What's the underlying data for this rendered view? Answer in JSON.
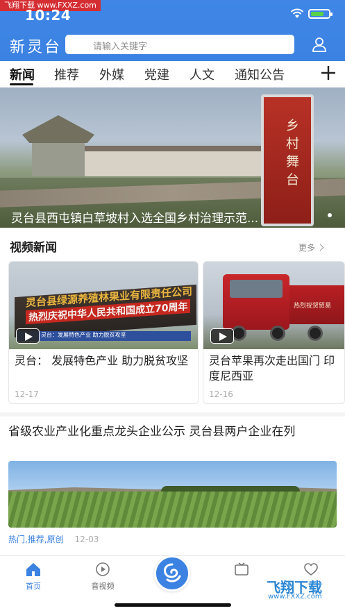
{
  "status_bar": {
    "time": "10:24",
    "watermark_tag": "飞翔下载 www.FXXZ.com"
  },
  "header": {
    "brand": "新灵台",
    "search_placeholder": "请输入关键字",
    "accent_color": "#3b82e2"
  },
  "tabs": [
    "新闻",
    "推荐",
    "外媒",
    "党建",
    "人文",
    "通知公告"
  ],
  "active_tab_index": 0,
  "banner": {
    "caption": "灵台县西屯镇白草坡村入选全国乡村治理示范...",
    "monument_text": "乡村舞台"
  },
  "video_section": {
    "title": "视频新闻",
    "more_label": "更多",
    "cards": [
      {
        "title": "灵台：  发展特色产业 助力脱贫攻坚",
        "date": "12-17",
        "thumb_board_text": "灵台县绿源养殖林果业有限责任公司",
        "thumb_banner_text": "热烈庆祝中华人民共和国成立70周年",
        "thumb_ticker": "灵台：发展特色产业 助力脱贫攻坚"
      },
      {
        "title": "灵台苹果再次走出国门 印度尼西亚",
        "date": "12-16",
        "thumb_truck_text": "热烈祝贺贸易"
      }
    ]
  },
  "article": {
    "title": "省级农业产业化重点龙头企业公示  灵台县两户企业在列",
    "tags": "热门,推荐,原创",
    "date": "12-03"
  },
  "bottom_nav": {
    "items": [
      {
        "label": "首页",
        "icon": "home-icon"
      },
      {
        "label": "音视频",
        "icon": "play-circle-icon"
      }
    ]
  },
  "watermark": {
    "brand": "飞翔下载",
    "url": "www.FXXZ.com"
  }
}
